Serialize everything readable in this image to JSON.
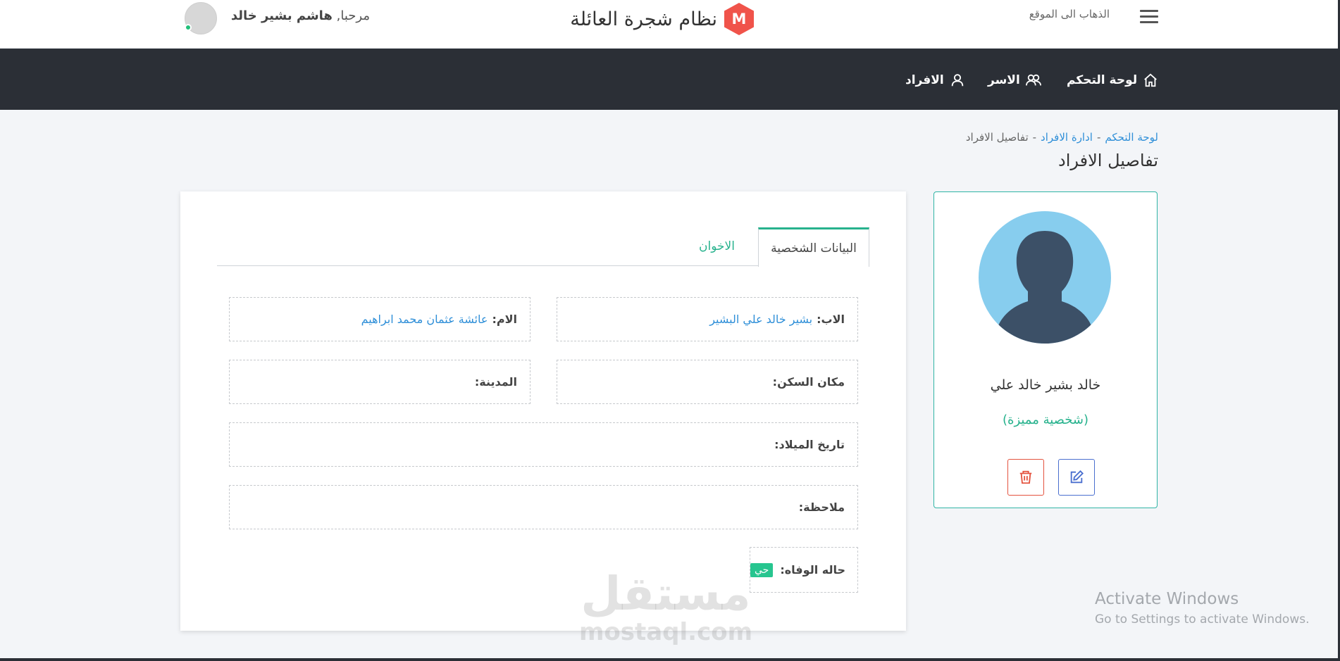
{
  "header": {
    "goto_site": "الذهاب الى الموقع",
    "logo_letter": "M",
    "logo_text": "نظام شجرة العائلة",
    "greeting_prefix": "مرحبا,",
    "user_name": "هاشم بشير خالد"
  },
  "nav": {
    "items": [
      {
        "label": "لوحة التحكم",
        "icon": "home-icon"
      },
      {
        "label": "الاسر",
        "icon": "users-icon"
      },
      {
        "label": "الافراد",
        "icon": "user-icon"
      }
    ]
  },
  "breadcrumb": {
    "items": [
      "لوحة التحكم",
      "ادارة الافراد",
      "تفاصيل الافراد"
    ],
    "separator": "-"
  },
  "page": {
    "title": "تفاصيل الافراد"
  },
  "profile": {
    "name": "خالد بشير خالد علي",
    "tag": "(شخصية مميزة)"
  },
  "tabs": {
    "personal": "البيانات الشخصية",
    "siblings": "الاخوان"
  },
  "details": {
    "father_label": "الاب:",
    "father_value": "بشير خالد علي البشير",
    "mother_label": "الام:",
    "mother_value": "عائشة عثمان محمد ابراهيم",
    "residence_label": "مكان السكن:",
    "city_label": "المدينة:",
    "birth_label": "تاريخ الميلاد:",
    "note_label": "ملاحظة:",
    "death_label": "حاله الوفاه:",
    "death_value": "حي"
  },
  "watermark": {
    "arabic": "مستقل",
    "latin": "mostaql.com"
  },
  "os_overlay": {
    "title": "Activate Windows",
    "subtitle": "Go to Settings to activate Windows."
  },
  "colors": {
    "navbar": "#2b2f36",
    "accent_green": "#27b28d",
    "link_blue": "#2f8fd8",
    "logo_red": "#f0534a",
    "danger": "#e4533f",
    "edit_blue": "#4a6fcf"
  }
}
